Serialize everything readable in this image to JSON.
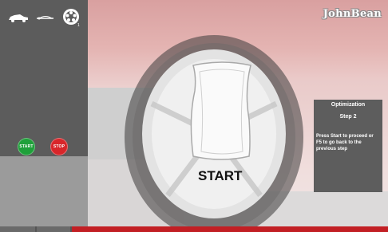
{
  "brand": "JohnBean",
  "toolbar": {
    "icons": [
      "car-icon",
      "balance-icon",
      "wheel-icon"
    ],
    "wheel_sub": "1"
  },
  "controls": {
    "start_label": "START",
    "stop_label": "STOP",
    "start_color": "#1fa03a",
    "stop_color": "#d8262a"
  },
  "main": {
    "instruction": "START"
  },
  "info": {
    "title": "Optimization",
    "step": "Step 2",
    "text": "Press Start to proceed or F5 to go back to the previous step"
  },
  "colors": {
    "accent": "#d8262a",
    "panel": "#5c5c5c"
  }
}
